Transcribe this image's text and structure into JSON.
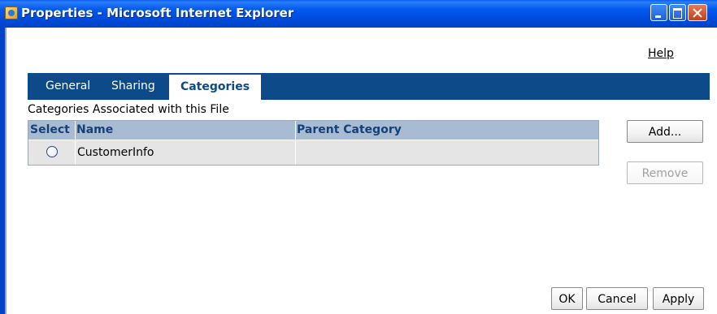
{
  "window": {
    "title": "Properties - Microsoft Internet Explorer"
  },
  "help_link": "Help",
  "tabs": [
    {
      "label": "General",
      "selected": false
    },
    {
      "label": "Sharing",
      "selected": false
    },
    {
      "label": "Categories",
      "selected": true
    }
  ],
  "section_title": "Categories Associated with this File",
  "table": {
    "headers": {
      "select": "Select",
      "name": "Name",
      "parent_category": "Parent Category"
    },
    "rows": [
      {
        "selected": false,
        "name": "CustomerInfo",
        "parent_category": ""
      }
    ]
  },
  "side_buttons": {
    "add": "Add...",
    "remove": "Remove"
  },
  "footer_buttons": {
    "ok": "OK",
    "cancel": "Cancel",
    "apply": "Apply"
  },
  "colors": {
    "titlebar": "#0054e3",
    "tabbar": "#0d4a8a",
    "table_header": "#a7bcd2",
    "row_bg": "#e5e5e5"
  },
  "icons": {
    "window_icon": "ie-page-icon",
    "minimize": "minimize-icon",
    "maximize": "maximize-icon",
    "close": "close-icon"
  }
}
